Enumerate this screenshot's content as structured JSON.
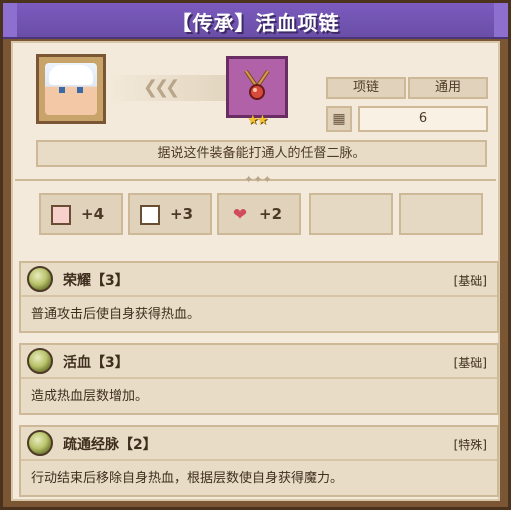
{
  "title": "【传承】活血项链",
  "item": {
    "type_tag": "项链",
    "usage_tag": "通用",
    "value": "6",
    "rarity_stars": "★★",
    "description": "据说这件装备能打通人的任督二脉。"
  },
  "stats": [
    {
      "icon": "fist-icon",
      "value": "+4"
    },
    {
      "icon": "book-icon",
      "value": "+3"
    },
    {
      "icon": "heart-icon",
      "value": "+2"
    }
  ],
  "traits": [
    {
      "name": "荣耀【3】",
      "type": "[基础]",
      "text": "普通攻击后使自身获得热血。"
    },
    {
      "name": "活血【3】",
      "type": "[基础]",
      "text": "造成热血层数增加。"
    },
    {
      "name": "疏通经脉【2】",
      "type": "[特殊]",
      "text": "行动结束后移除自身热血，根据层数使自身获得魔力。"
    }
  ],
  "colors": {
    "title_bar": "#6a4ea6",
    "frame": "#7a5634",
    "parchment": "#f3eadb",
    "item_frame": "#b061a8"
  }
}
